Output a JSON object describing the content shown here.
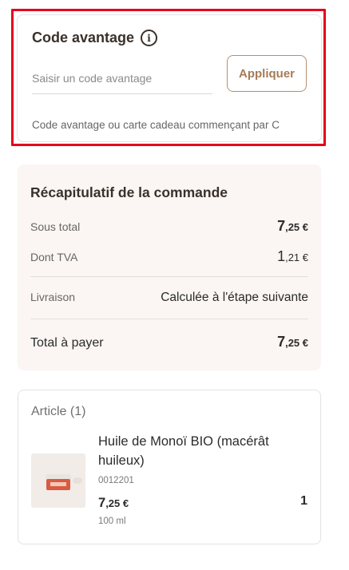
{
  "promo": {
    "title": "Code avantage",
    "info_icon": "info-icon",
    "input_placeholder": "Saisir un code avantage",
    "input_value": "",
    "apply_label": "Appliquer",
    "hint": "Code avantage ou carte cadeau commençant par C",
    "highlight_color": "#e4001f"
  },
  "summary": {
    "title": "Récapitulatif de la commande",
    "rows": {
      "subtotal": {
        "label": "Sous total",
        "int": "7",
        "dec": ",25 €"
      },
      "vat": {
        "label": "Dont TVA",
        "int": "1",
        "dec": ",21 €"
      },
      "shipping": {
        "label": "Livraison",
        "value": "Calculée à l'étape suivante"
      },
      "total": {
        "label": "Total à payer",
        "int": "7",
        "dec": ",25 €"
      }
    },
    "background": "#fbf6f3"
  },
  "article": {
    "header": "Article (1)",
    "items": [
      {
        "name": "Huile de Monoï BIO (macérât huileux)",
        "ref": "0012201",
        "price_int": "7",
        "price_dec": ",25 €",
        "size": "100 ml",
        "quantity": "1"
      }
    ]
  },
  "colors": {
    "accent": "#a67b55",
    "title": "#3a302b"
  }
}
